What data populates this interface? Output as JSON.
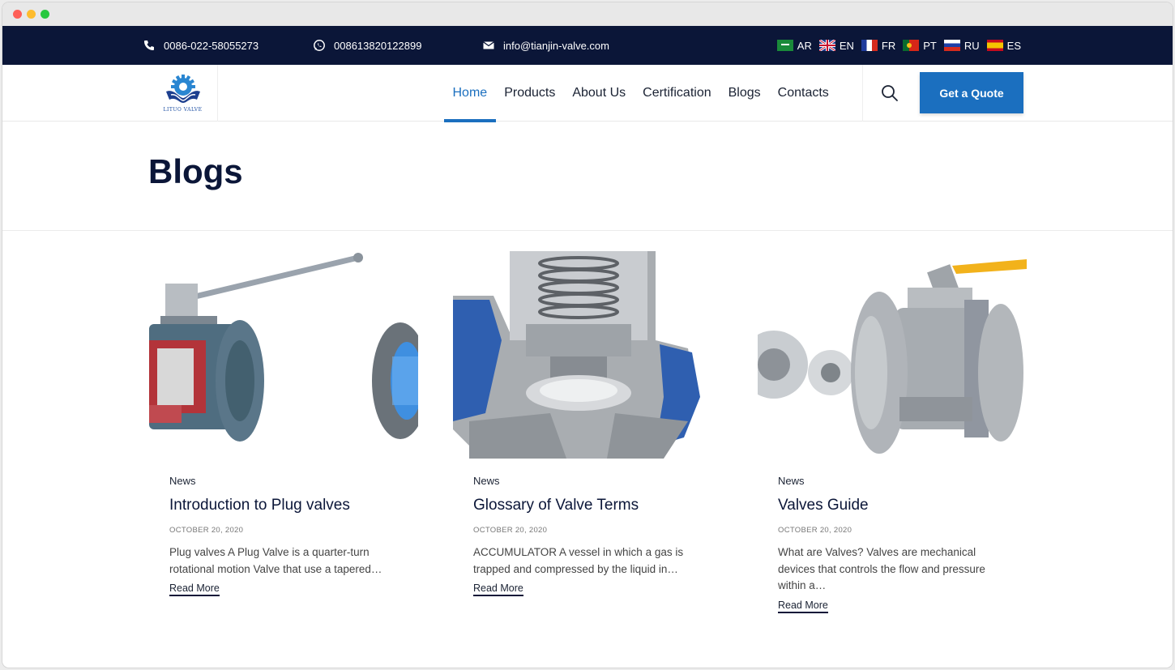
{
  "topbar": {
    "phone": "0086-022-58055273",
    "whatsapp": "008613820122899",
    "email": "info@tianjin-valve.com",
    "languages": [
      "AR",
      "EN",
      "FR",
      "PT",
      "RU",
      "ES"
    ]
  },
  "nav": {
    "logo_text": "LITUO VALVE",
    "items": [
      "Home",
      "Products",
      "About Us",
      "Certification",
      "Blogs",
      "Contacts"
    ],
    "active": "Home",
    "quote_button": "Get a Quote"
  },
  "page": {
    "title": "Blogs"
  },
  "posts": [
    {
      "category": "News",
      "title": "Introduction to Plug valves",
      "date": "OCTOBER 20, 2020",
      "excerpt": "Plug valves A Plug Valve is a quarter-turn rotational motion Valve that use a tapered…",
      "read_more": "Read More"
    },
    {
      "category": "News",
      "title": "Glossary of Valve Terms",
      "date": "OCTOBER 20, 2020",
      "excerpt": "ACCUMULATOR A vessel in which a gas is trapped and compressed by the liquid in…",
      "read_more": "Read More"
    },
    {
      "category": "News",
      "title": "Valves Guide",
      "date": "OCTOBER 20, 2020",
      "excerpt": "What are Valves? Valves are mechanical devices that controls the flow and pressure within a…",
      "read_more": "Read More"
    }
  ],
  "colors": {
    "topbar": "#0b1638",
    "accent": "#1b6fbf"
  }
}
